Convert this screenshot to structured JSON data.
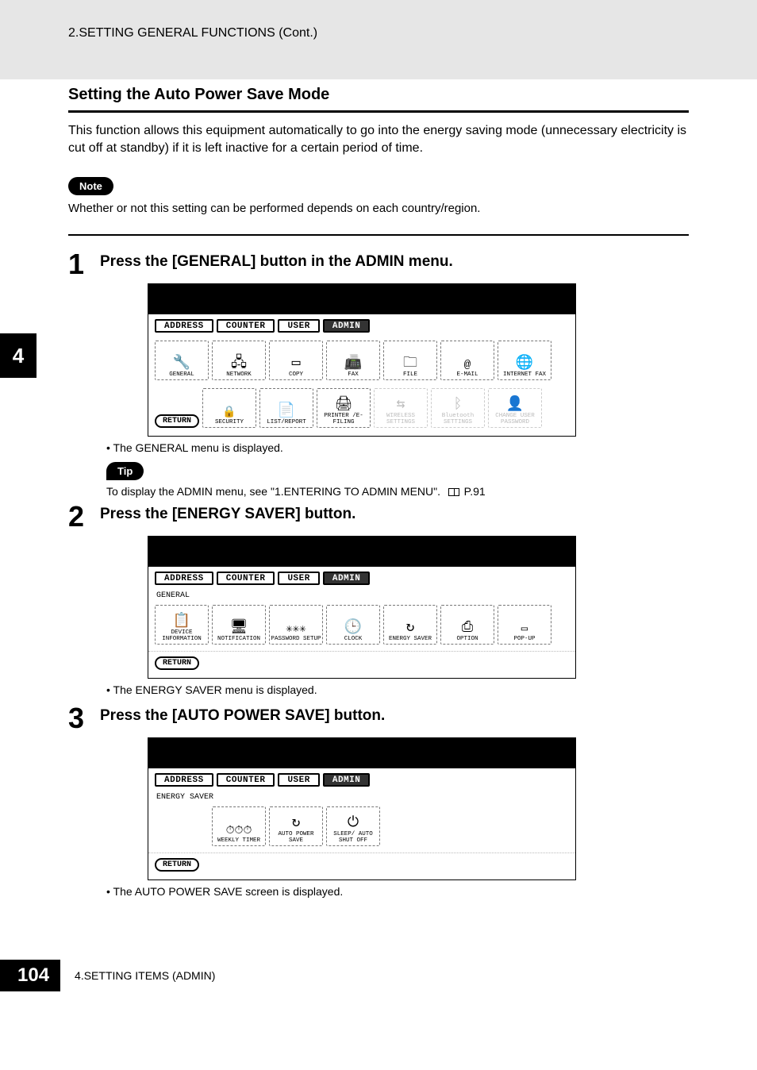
{
  "header": {
    "breadcrumb": "2.SETTING GENERAL FUNCTIONS (Cont.)"
  },
  "side_tab": "4",
  "section": {
    "title": "Setting the Auto Power Save Mode",
    "intro": "This function allows this equipment automatically to go into the energy saving mode (unnecessary electricity is cut off at standby) if it is left inactive for a certain period of time."
  },
  "note": {
    "label": "Note",
    "text": "Whether or not this setting can be performed depends on each country/region."
  },
  "steps": [
    {
      "num": "1",
      "title": "Press the [GENERAL] button in the ADMIN menu.",
      "after_bullet": "The GENERAL menu is displayed."
    },
    {
      "num": "2",
      "title": "Press the [ENERGY SAVER] button.",
      "after_bullet": "The ENERGY SAVER menu is displayed."
    },
    {
      "num": "3",
      "title": "Press the [AUTO POWER SAVE] button.",
      "after_bullet": "The AUTO POWER SAVE screen is displayed."
    }
  ],
  "tip": {
    "label": "Tip",
    "text_prefix": "To display the ADMIN menu, see \"1.ENTERING TO ADMIN MENU\".",
    "page_ref": "P.91"
  },
  "ui": {
    "tabs": {
      "address": "ADDRESS",
      "counter": "COUNTER",
      "user": "USER",
      "admin": "ADMIN"
    },
    "return": "RETURN",
    "screen1": {
      "row1": [
        "GENERAL",
        "NETWORK",
        "COPY",
        "FAX",
        "FILE",
        "E-MAIL",
        "INTERNET FAX"
      ],
      "row2": [
        "SECURITY",
        "LIST/REPORT",
        "PRINTER /E-FILING"
      ],
      "row2_dim": [
        "WIRELESS SETTINGS",
        "Bluetooth SETTINGS",
        "CHANGE USER PASSWORD"
      ]
    },
    "screen2": {
      "sub": "GENERAL",
      "row": [
        "DEVICE INFORMATION",
        "NOTIFICATION",
        "PASSWORD SETUP",
        "CLOCK",
        "ENERGY SAVER",
        "OPTION",
        "POP-UP"
      ]
    },
    "screen3": {
      "sub": "ENERGY SAVER",
      "row": [
        "WEEKLY TIMER",
        "AUTO POWER SAVE",
        "SLEEP/ AUTO SHUT OFF"
      ]
    }
  },
  "footer": {
    "page": "104",
    "chapter": "4.SETTING ITEMS (ADMIN)"
  }
}
